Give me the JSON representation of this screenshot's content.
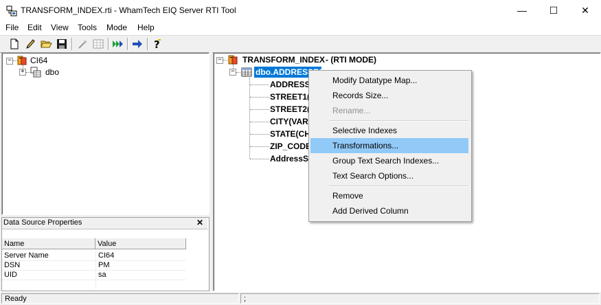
{
  "window": {
    "title": "TRANSFORM_INDEX.rti - WhamTech EIQ Server RTI Tool",
    "minimize_glyph": "—",
    "maximize_glyph": "☐",
    "close_glyph": "✕"
  },
  "menu": [
    "File",
    "Edit",
    "View",
    "Tools",
    "Mode",
    "Help"
  ],
  "toolbar": {
    "buttons": [
      "new-document-icon",
      "pencil-icon",
      "open-folder-icon",
      "save-icon",
      "magic-wand-icon",
      "table-grid-icon",
      "run-arrows-icon",
      "right-arrow-icon",
      "help-icon"
    ]
  },
  "left_tree": {
    "root_label": "CI64",
    "child_label": "dbo"
  },
  "right_tree": {
    "root_label": "TRANSFORM_INDEX",
    "root_mode": "- (RTI MODE)",
    "table_label": "dbo.ADDRESSES",
    "columns": [
      "ADDRESS_",
      "STREET1(V",
      "STREET2(V",
      "CITY(VARC",
      "STATE(CH.",
      "ZIP_CODE(",
      "AddressSt"
    ]
  },
  "properties": {
    "title": "Data Source Properties",
    "close_glyph": "✕",
    "col_name": "Name",
    "col_value": "Value",
    "rows": [
      {
        "name": "Server Name",
        "value": "CI64"
      },
      {
        "name": "DSN",
        "value": "PM"
      },
      {
        "name": "UID",
        "value": "sa"
      }
    ]
  },
  "context_menu": {
    "groups": [
      [
        {
          "label": "Modify Datatype Map...",
          "state": "normal"
        },
        {
          "label": "Records Size...",
          "state": "normal"
        },
        {
          "label": "Rename...",
          "state": "disabled"
        }
      ],
      [
        {
          "label": "Selective Indexes",
          "state": "normal"
        },
        {
          "label": "Transformations...",
          "state": "highlighted"
        },
        {
          "label": "Group Text Search Indexes...",
          "state": "normal"
        },
        {
          "label": "Text Search Options...",
          "state": "normal"
        }
      ],
      [
        {
          "label": "Remove",
          "state": "normal"
        },
        {
          "label": "Add Derived Column",
          "state": "normal"
        }
      ]
    ]
  },
  "status": {
    "text": "Ready",
    "second_pane": ";"
  },
  "colors": {
    "selection": "#0078d7",
    "menu_highlight": "#91c9f7"
  }
}
